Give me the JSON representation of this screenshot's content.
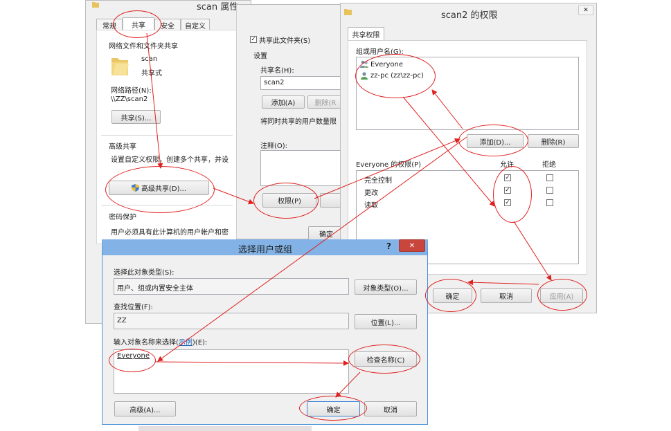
{
  "props": {
    "title": "scan 属性",
    "tabs": [
      "常规",
      "共享",
      "安全",
      "自定义"
    ],
    "network_share_header": "网络文件和文件夹共享",
    "folder_name": "scan",
    "folder_state": "共享式",
    "network_path_label": "网络路径(N):",
    "network_path_value": "\\\\ZZ\\scan2",
    "share_button": "共享(S)...",
    "advanced_share_header": "高级共享",
    "advanced_share_desc": "设置自定义权限，创建多个共享，并设",
    "advanced_share_button": "高级共享(D)...",
    "password_header": "密码保护",
    "password_desc": "用户必须具有此计算机的用户帐户和密"
  },
  "adv": {
    "share_checkbox": "共享此文件夹(S)",
    "settings_header": "设置",
    "share_name_label": "共享名(H):",
    "share_name_value": "scan2",
    "add_button": "添加(A)",
    "remove_button": "删除(R",
    "limit_label": "将同时共享的用户数量限",
    "comment_label": "注释(O):",
    "permissions_button": "权限(P)",
    "ok_button": "确定"
  },
  "perm": {
    "title": "scan2 的权限",
    "tab": "共享权限",
    "group_label": "组或用户名(G):",
    "users": [
      "Everyone",
      "zz-pc (zz\\zz-pc)"
    ],
    "add_button": "添加(D)...",
    "remove_button": "删除(R)",
    "perm_label": "Everyone 的权限(P)",
    "allow_header": "允许",
    "deny_header": "拒绝",
    "rows": [
      {
        "name": "完全控制",
        "allow": "✓",
        "deny": ""
      },
      {
        "name": "更改",
        "allow": "✓",
        "deny": ""
      },
      {
        "name": "读取",
        "allow": "✓",
        "deny": ""
      }
    ],
    "ok_button": "确定",
    "cancel_button": "取消",
    "apply_button": "应用(A)"
  },
  "select": {
    "title": "选择用户或组",
    "help": "?",
    "close": "✕",
    "object_type_label": "选择此对象类型(S):",
    "object_type_value": "用户、组或内置安全主体",
    "object_type_button": "对象类型(O)...",
    "location_label": "查找位置(F):",
    "location_value": "ZZ",
    "location_button": "位置(L)...",
    "enter_label_pre": "输入对象名称来选择(",
    "enter_label_link": "示例",
    "enter_label_post": ")(E):",
    "enter_value": "Everyone",
    "check_names_button": "检查名称(C)",
    "advanced_button": "高级(A)...",
    "ok_button": "确定",
    "cancel_button": "取消"
  },
  "colors": {
    "annotation": "#e02020",
    "title_active": "#4a90d9",
    "close_button": "#c9463d"
  }
}
